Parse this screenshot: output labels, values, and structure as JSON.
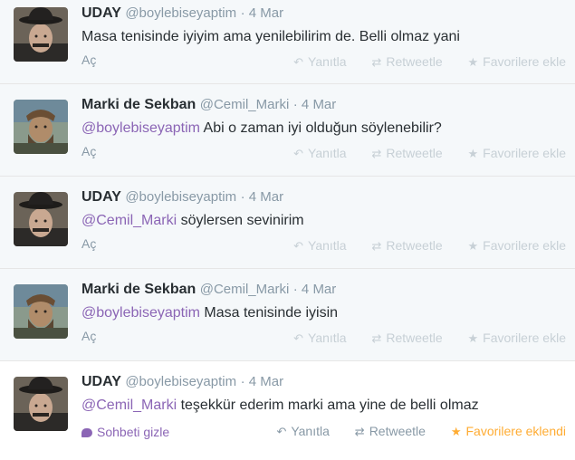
{
  "colors": {
    "mention": "#8b65b5",
    "meta_gray": "#8899a6",
    "faded_action": "#c7d0d6",
    "favorited": "#ffac33"
  },
  "tweets": [
    {
      "fullname": "UDAY",
      "username": "@boylebiseyaptim",
      "time": "· 4 Mar",
      "mention": "",
      "text": "Masa tenisinde iyiyim ama yenilebilirim de. Belli olmaz yani",
      "expand": "Aç",
      "reply": "Yanıtla",
      "retweet": "Retweetle",
      "favorite": "Favorilere ekle"
    },
    {
      "fullname": "Marki de Sekban",
      "username": "@Cemil_Marki",
      "time": "· 4 Mar",
      "mention": "@boylebiseyaptim",
      "text": " Abi o zaman iyi olduğun söylenebilir?",
      "expand": "Aç",
      "reply": "Yanıtla",
      "retweet": "Retweetle",
      "favorite": "Favorilere ekle"
    },
    {
      "fullname": "UDAY",
      "username": "@boylebiseyaptim",
      "time": "· 4 Mar",
      "mention": "@Cemil_Marki",
      "text": " söylersen sevinirim",
      "expand": "Aç",
      "reply": "Yanıtla",
      "retweet": "Retweetle",
      "favorite": "Favorilere ekle"
    },
    {
      "fullname": "Marki de Sekban",
      "username": "@Cemil_Marki",
      "time": "· 4 Mar",
      "mention": "@boylebiseyaptim",
      "text": " Masa tenisinde iyisin",
      "expand": "Aç",
      "reply": "Yanıtla",
      "retweet": "Retweetle",
      "favorite": "Favorilere ekle"
    },
    {
      "fullname": "UDAY",
      "username": "@boylebiseyaptim",
      "time": "· 4 Mar",
      "mention": "@Cemil_Marki",
      "text": " teşekkür ederim marki ama yine de belli olmaz",
      "expand": "Sohbeti gizle",
      "reply": "Yanıtla",
      "retweet": "Retweetle",
      "favorite": "Favorilere eklendi"
    }
  ],
  "icons": {
    "reply": "reply-icon",
    "retweet": "retweet-icon",
    "favorite": "star-icon",
    "conversation": "speech-bubble-icon"
  }
}
